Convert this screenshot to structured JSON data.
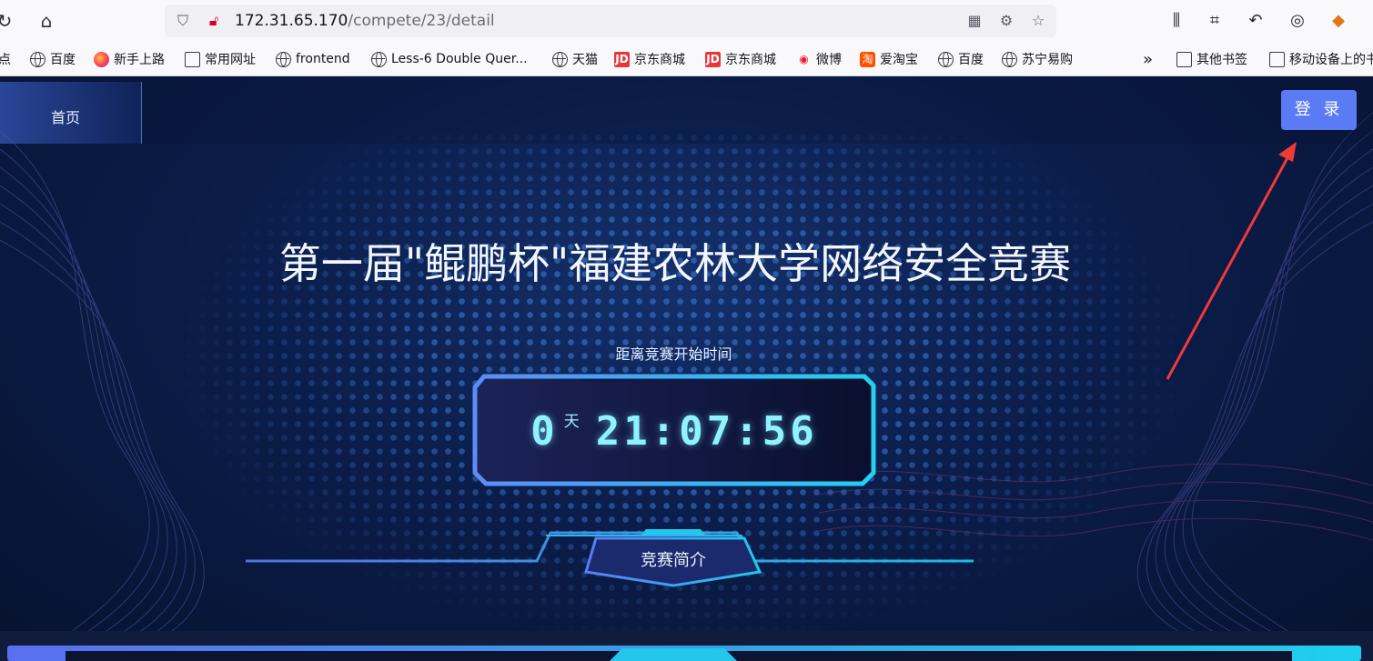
{
  "browser": {
    "url_host": "172.31.65.170",
    "url_path": "/compete/23/detail",
    "bookmarks": [
      {
        "label": "点",
        "icon": "none"
      },
      {
        "label": "百度",
        "icon": "globe-icon"
      },
      {
        "label": "新手上路",
        "icon": "firefox-icon"
      },
      {
        "label": "常用网址",
        "icon": "folder-icon"
      },
      {
        "label": "frontend",
        "icon": "globe-icon"
      },
      {
        "label": "Less-6 Double Quer...",
        "icon": "globe-icon"
      },
      {
        "label": "天猫",
        "icon": "globe-icon"
      },
      {
        "label": "京东商城",
        "icon": "jd-icon"
      },
      {
        "label": "京东商城",
        "icon": "jd-icon"
      },
      {
        "label": "微博",
        "icon": "weibo-icon"
      },
      {
        "label": "爱淘宝",
        "icon": "taobao-icon"
      },
      {
        "label": "百度",
        "icon": "globe-icon"
      },
      {
        "label": "苏宁易购",
        "icon": "globe-icon"
      }
    ],
    "overflow_label": "»",
    "other_bookmarks": "其他书签",
    "mobile_bookmarks": "移动设备上的书"
  },
  "page": {
    "nav_home": "首页",
    "login_button": "登 录",
    "title": "第一届\"鲲鹏杯\"福建农林大学网络安全竞赛",
    "countdown_label": "距离竞赛开始时间",
    "countdown": {
      "days": "0",
      "day_unit": "天",
      "time": "21:07:56"
    },
    "intro_tab": "竞赛简介"
  },
  "colors": {
    "accent": "#5b7bf5",
    "digit": "#8ff2ff",
    "background": "#0b1d4a",
    "annotation_arrow": "#f03a3a"
  }
}
